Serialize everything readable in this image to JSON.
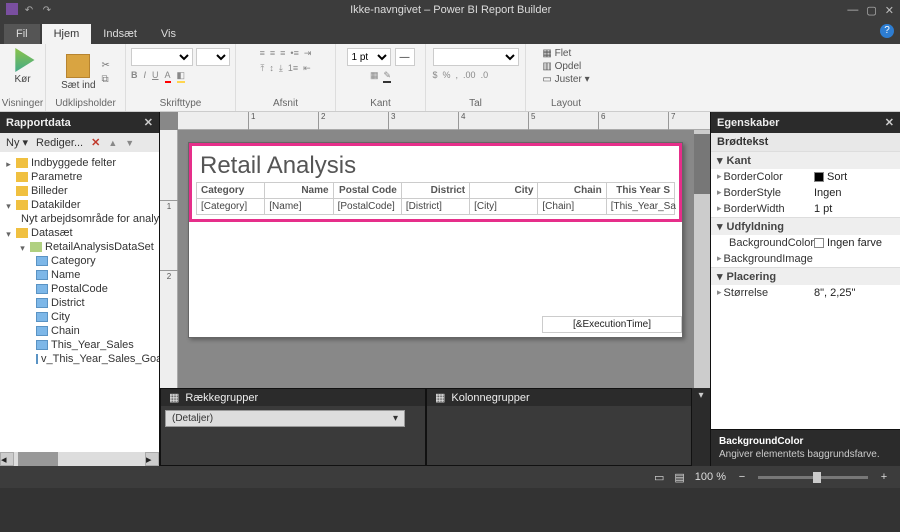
{
  "window": {
    "title": "Ikke-navngivet – Power BI Report Builder"
  },
  "menu": {
    "fil": "Fil",
    "hjem": "Hjem",
    "indsaet": "Indsæt",
    "vis": "Vis"
  },
  "ribbon": {
    "visninger": "Visninger",
    "kor": "Kør",
    "saet_ind": "Sæt ind",
    "udklip": "Udklipsholder",
    "skrifttype": "Skrifttype",
    "afsnit": "Afsnit",
    "kant": "Kant",
    "tal": "Tal",
    "layout": "Layout",
    "flet": "Flet",
    "opdel": "Opdel",
    "juster": "Juster",
    "pt": "1 pt"
  },
  "reportdata": {
    "title": "Rapportdata",
    "ny": "Ny",
    "rediger": "Rediger...",
    "nodes": {
      "builtin": "Indbyggede felter",
      "params": "Parametre",
      "images": "Billeder",
      "datasources": "Datakilder",
      "ds1": "Nyt arbejdsområde for analy",
      "datasets": "Datasæt",
      "dataset1": "RetailAnalysisDataSet",
      "fields": [
        "Category",
        "Name",
        "PostalCode",
        "District",
        "City",
        "Chain",
        "This_Year_Sales",
        "v_This_Year_Sales_Goal"
      ]
    }
  },
  "design": {
    "title": "Retail Analysis",
    "headers": [
      "Category",
      "Name",
      "Postal Code",
      "District",
      "City",
      "Chain",
      "This Year S"
    ],
    "fields": [
      "[Category]",
      "[Name]",
      "[PostalCode]",
      "[District]",
      "[City]",
      "[Chain]",
      "[This_Year_Sa"
    ],
    "footer": "[&ExecutionTime]"
  },
  "groups": {
    "rows": "Rækkegrupper",
    "cols": "Kolonnegrupper",
    "details": "(Detaljer)"
  },
  "properties": {
    "title": "Egenskaber",
    "object": "Brødtekst",
    "groups": {
      "kant": "Kant",
      "udfyld": "Udfyldning",
      "placering": "Placering"
    },
    "rows": {
      "bordercolor_n": "BorderColor",
      "bordercolor_v": "Sort",
      "borderstyle_n": "BorderStyle",
      "borderstyle_v": "Ingen",
      "borderwidth_n": "BorderWidth",
      "borderwidth_v": "1 pt",
      "bgcolor_n": "BackgroundColor",
      "bgcolor_v": "Ingen farve",
      "bgimage_n": "BackgroundImage",
      "size_n": "Størrelse",
      "size_v": "8\", 2,25\""
    },
    "desc_title": "BackgroundColor",
    "desc_text": "Angiver elementets baggrundsfarve."
  },
  "status": {
    "zoom": "100 %"
  }
}
